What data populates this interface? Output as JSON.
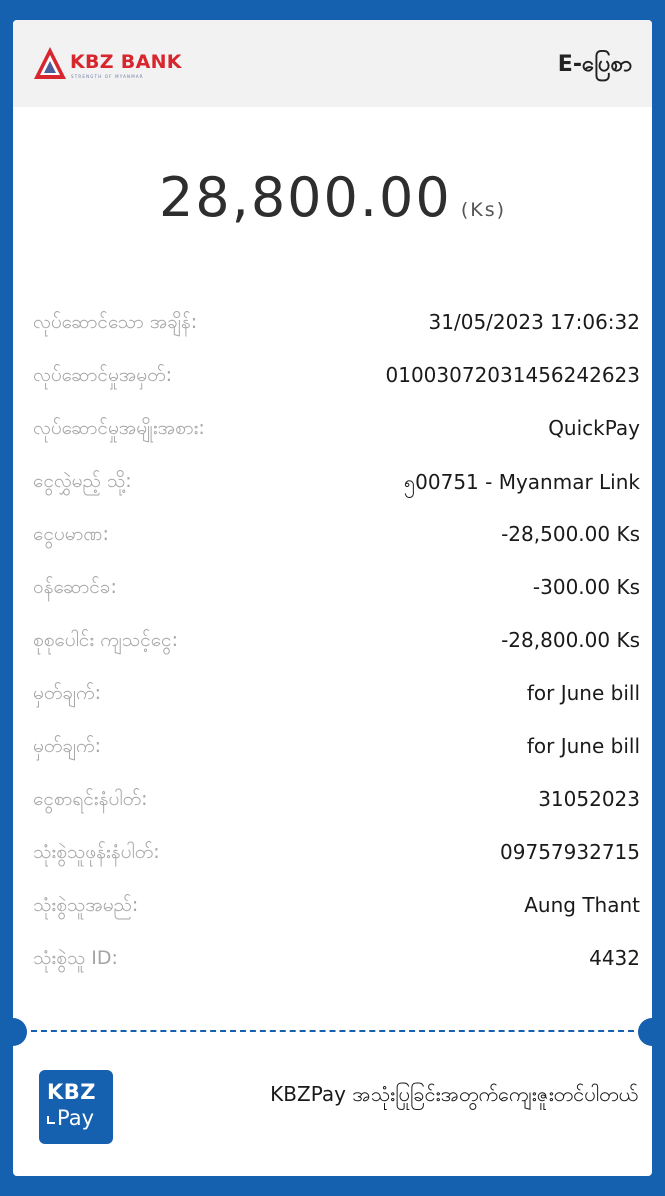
{
  "header": {
    "bank_name": "KBZ BANK",
    "tagline": "STRENGTH OF MYANMAR",
    "title": "E-ပြေစာ"
  },
  "amount": {
    "value": "28,800.00",
    "unit": "(Ks)"
  },
  "details": [
    {
      "label": "လုပ်ဆောင်သော အချိန်:",
      "value": "31/05/2023 17:06:32"
    },
    {
      "label": "လုပ်ဆောင်မှုအမှတ်:",
      "value": "01003072031456242623"
    },
    {
      "label": "လုပ်ဆောင်မှုအမျိုးအစား:",
      "value": "QuickPay"
    },
    {
      "label": "ငွေလွှဲမည့် သို့:",
      "value": "၅00751 - Myanmar Link"
    },
    {
      "label": "ငွေပမာဏ:",
      "value": "-28,500.00 Ks"
    },
    {
      "label": "ဝန်ဆောင်ခ:",
      "value": "-300.00 Ks"
    },
    {
      "label": "စုစုပေါင်း ကျသင့်ငွေ:",
      "value": "-28,800.00 Ks"
    },
    {
      "label": "မှတ်ချက်:",
      "value": "for June bill"
    },
    {
      "label": "မှတ်ချက်:",
      "value": "for June bill"
    },
    {
      "label": "ငွေစာရင်းနံပါတ်:",
      "value": "31052023"
    },
    {
      "label": "သုံးစွဲသူဖုန်းနံပါတ်:",
      "value": "09757932715"
    },
    {
      "label": "သုံးစွဲသူအမည်:",
      "value": "Aung Thant"
    },
    {
      "label": "သုံးစွဲသူ ID:",
      "value": "4432"
    }
  ],
  "footer": {
    "logo_line1": "KBZ",
    "logo_line2": "Pay",
    "message": "KBZPay အသုံးပြုခြင်းအတွက်ကျေးဇူးတင်ပါတယ်"
  },
  "colors": {
    "brand_blue": "#1660b0",
    "brand_red": "#d8262f"
  }
}
